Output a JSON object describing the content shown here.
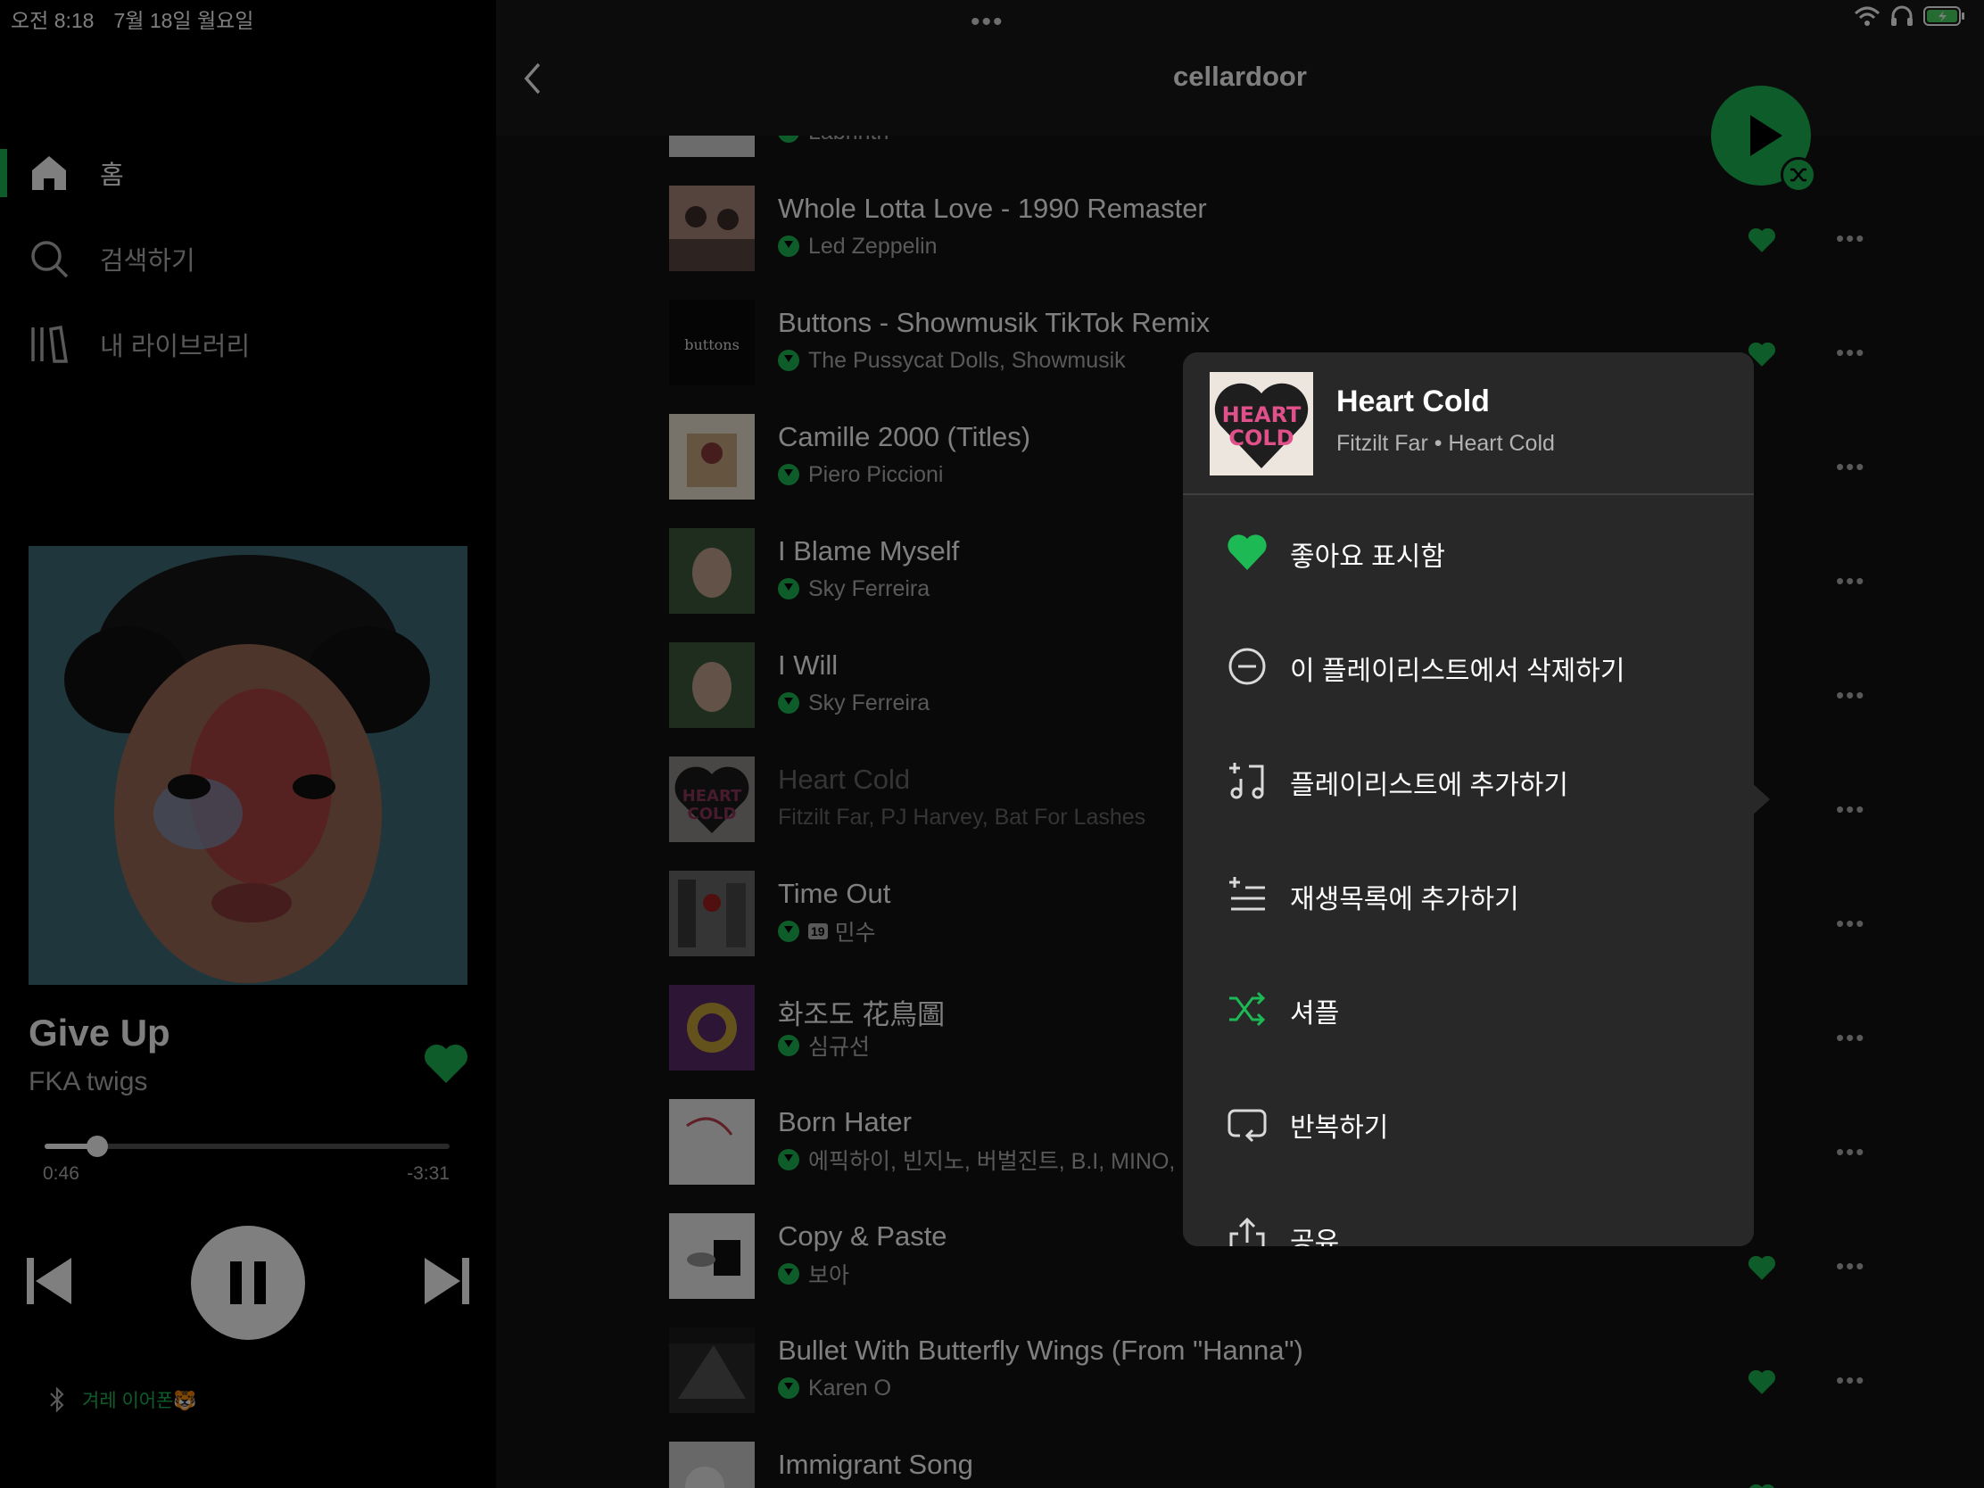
{
  "status": {
    "time": "오전 8:18",
    "date": "7월 18일 월요일"
  },
  "colors": {
    "accent": "#1db954",
    "background": "#121212",
    "surface": "#282828"
  },
  "sidebar": {
    "items": [
      {
        "label": "홈",
        "icon": "home-icon",
        "active": true
      },
      {
        "label": "검색하기",
        "icon": "search-icon",
        "active": false
      },
      {
        "label": "내 라이브러리",
        "icon": "library-icon",
        "active": false
      }
    ]
  },
  "now_playing": {
    "title": "Give Up",
    "artist": "FKA twigs",
    "elapsed": "0:46",
    "remaining": "-3:31",
    "progress": 0.13,
    "liked": true,
    "device": "겨레 이어폰🐯"
  },
  "playlist": {
    "title": "cellardoor",
    "tracks": [
      {
        "name": "",
        "artist": "Labrinth",
        "liked": false
      },
      {
        "name": "Whole Lotta Love - 1990 Remaster",
        "artist": "Led Zeppelin",
        "liked": true
      },
      {
        "name": "Buttons - Showmusik TikTok Remix",
        "artist": "The Pussycat Dolls, Showmusik",
        "liked": true
      },
      {
        "name": "Camille 2000 (Titles)",
        "artist": "Piero Piccioni",
        "liked": false
      },
      {
        "name": "I Blame Myself",
        "artist": "Sky Ferreira",
        "liked": false
      },
      {
        "name": "I Will",
        "artist": "Sky Ferreira",
        "liked": false
      },
      {
        "name": "Heart Cold",
        "artist": "Fitzilt Far, PJ Harvey, Bat For Lashes",
        "liked": false
      },
      {
        "name": "Time Out",
        "artist": "민수",
        "liked": false
      },
      {
        "name": "화조도 花鳥圖",
        "artist": "심규선",
        "liked": false
      },
      {
        "name": "Born Hater",
        "artist": "에픽하이, 빈지노, 버벌진트, B.I, MINO, B",
        "liked": false
      },
      {
        "name": "Copy & Paste",
        "artist": "보아",
        "liked": true
      },
      {
        "name": "Bullet With Butterfly Wings (From \"Hanna\")",
        "artist": "Karen O",
        "liked": true
      },
      {
        "name": "Immigrant Song",
        "artist": "",
        "liked": true
      }
    ]
  },
  "context_menu": {
    "title": "Heart Cold",
    "subtitle": "Fitzilt Far • Heart Cold",
    "items": [
      {
        "label": "좋아요 표시함",
        "icon": "heart-filled-icon"
      },
      {
        "label": "이 플레이리스트에서 삭제하기",
        "icon": "minus-circle-icon"
      },
      {
        "label": "플레이리스트에 추가하기",
        "icon": "add-to-playlist-icon"
      },
      {
        "label": "재생목록에 추가하기",
        "icon": "add-to-queue-icon"
      },
      {
        "label": "셔플",
        "icon": "shuffle-icon"
      },
      {
        "label": "반복하기",
        "icon": "repeat-icon"
      },
      {
        "label": "공유",
        "icon": "share-icon"
      }
    ]
  }
}
